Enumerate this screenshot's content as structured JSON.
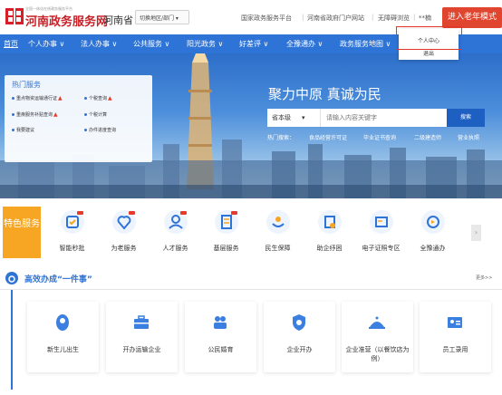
{
  "header": {
    "site_small": "全国一体化在线政务服务平台",
    "site_title": "河南政务服务网",
    "province": "河南省",
    "region_switch": "切换地区/部门 ▾",
    "links": [
      "国家政务服务平台",
      "河南省政府门户网站",
      "无障碍浏览"
    ],
    "user_name": "**楠",
    "elder_mode": "进入老年模式"
  },
  "user_menu": {
    "items": [
      "个人中心",
      "退出"
    ]
  },
  "nav": {
    "items": [
      "首页",
      "个人办事 ∨",
      "法人办事 ∨",
      "公共服务 ∨",
      "阳光政务 ∨",
      "好差评 ∨",
      "全豫通办 ∨",
      "政务服务地图 ∨"
    ]
  },
  "hero": {
    "hot_title": "热门服务",
    "hot_items": [
      "重点物资运输通行证",
      "个税查询",
      "重疾服务补贴查询",
      "个税计算",
      "我要建议",
      "办件进度查询"
    ],
    "slogan": "聚力中原  真诚为民",
    "search_scope": "省本级",
    "search_placeholder": "请输入内容关键字",
    "search_button": "搜索",
    "hot_search_label": "热门搜索：",
    "hot_search_terms": [
      "食品经营许可证",
      "毕业证书查询",
      "二级建造师",
      "营业执照"
    ]
  },
  "features": {
    "label": "特色服务",
    "items": [
      {
        "label": "智能秒批",
        "icon": "smart-approve-icon",
        "badge": true
      },
      {
        "label": "为老服务",
        "icon": "elderly-service-icon",
        "badge": true
      },
      {
        "label": "人才服务",
        "icon": "talent-service-icon",
        "badge": true
      },
      {
        "label": "基层服务",
        "icon": "grassroots-service-icon",
        "badge": true
      },
      {
        "label": "民生保障",
        "icon": "livelihood-icon",
        "badge": false
      },
      {
        "label": "助企纾困",
        "icon": "enterprise-help-icon",
        "badge": false
      },
      {
        "label": "电子证照专区",
        "icon": "e-license-icon",
        "badge": false
      },
      {
        "label": "全豫通办",
        "icon": "province-wide-icon",
        "badge": false
      }
    ],
    "next": "›"
  },
  "section": {
    "title": "高效办成“一件事”",
    "more": "更多>>",
    "cards": [
      {
        "label": "新生儿出生",
        "icon": "newborn-icon"
      },
      {
        "label": "开办运输企业",
        "icon": "briefcase-icon"
      },
      {
        "label": "公民婚育",
        "icon": "couple-icon"
      },
      {
        "label": "企业开办",
        "icon": "enterprise-open-icon"
      },
      {
        "label": "企业准营（以餐饮店为例）",
        "icon": "restaurant-icon"
      },
      {
        "label": "员工录用",
        "icon": "employee-card-icon"
      }
    ]
  },
  "colors": {
    "primary": "#2e73d6",
    "brand_red": "#c82127",
    "accent_orange": "#f6a623",
    "elder_button": "#e0452f",
    "highlight_box": "#e5332a"
  }
}
